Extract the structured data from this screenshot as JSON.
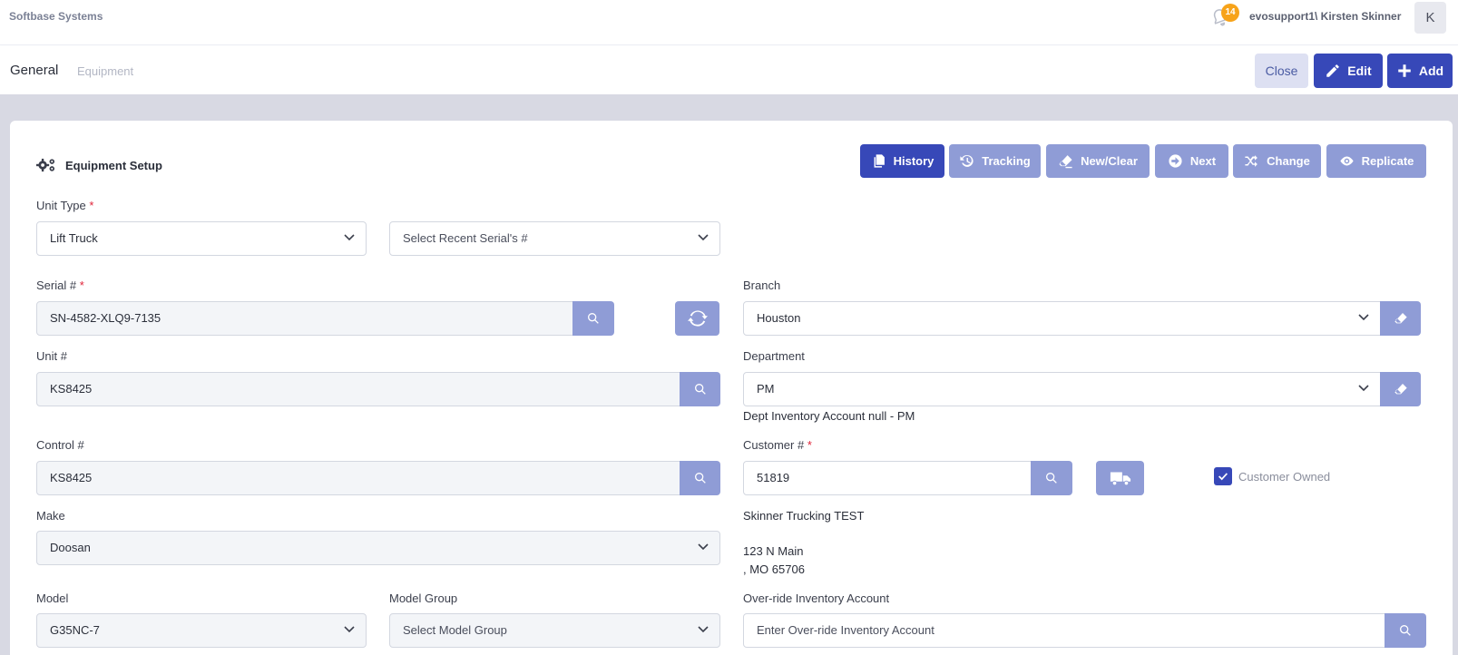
{
  "topbar": {
    "brand": "Softbase Systems",
    "notification_count": "14",
    "user": "evosupport1\\ Kirsten Skinner",
    "avatar_initial": "K"
  },
  "subbar": {
    "tab_general": "General",
    "tab_equipment": "Equipment",
    "close_label": "Close",
    "edit_label": "Edit",
    "add_label": "Add"
  },
  "card": {
    "title": "Equipment Setup",
    "toolbar": {
      "history": "History",
      "tracking": "Tracking",
      "new_clear": "New/Clear",
      "next": "Next",
      "change": "Change",
      "replicate": "Replicate"
    }
  },
  "form": {
    "unit_type": {
      "label": "Unit Type",
      "required": "*",
      "value": "Lift Truck"
    },
    "recent_serial": {
      "placeholder": "Select Recent Serial's #"
    },
    "serial": {
      "label": "Serial #",
      "required": "*",
      "value": "SN-4582-XLQ9-7135"
    },
    "branch": {
      "label": "Branch",
      "value": "Houston"
    },
    "unit_no": {
      "label": "Unit #",
      "value": "KS8425"
    },
    "department": {
      "label": "Department",
      "value": "PM",
      "note": "Dept Inventory Account null - PM"
    },
    "control_no": {
      "label": "Control #",
      "value": "KS8425"
    },
    "customer_no": {
      "label": "Customer #",
      "required": "*",
      "value": "51819"
    },
    "customer_owned": {
      "label": "Customer Owned",
      "checked": true
    },
    "customer_info": {
      "name": "Skinner Trucking TEST",
      "address1": "123 N Main",
      "address2": ", MO 65706"
    },
    "make": {
      "label": "Make",
      "value": "Doosan"
    },
    "model": {
      "label": "Model",
      "value": "G35NC-7"
    },
    "model_group": {
      "label": "Model Group",
      "placeholder": "Select Model Group"
    },
    "override_inventory": {
      "label": "Over-ride Inventory Account",
      "placeholder": "Enter Over-ride Inventory Account"
    }
  },
  "colors": {
    "primary": "#3748b8",
    "secondary": "#8f9cd6",
    "badge": "#f7a31a",
    "required": "#e0253a"
  }
}
